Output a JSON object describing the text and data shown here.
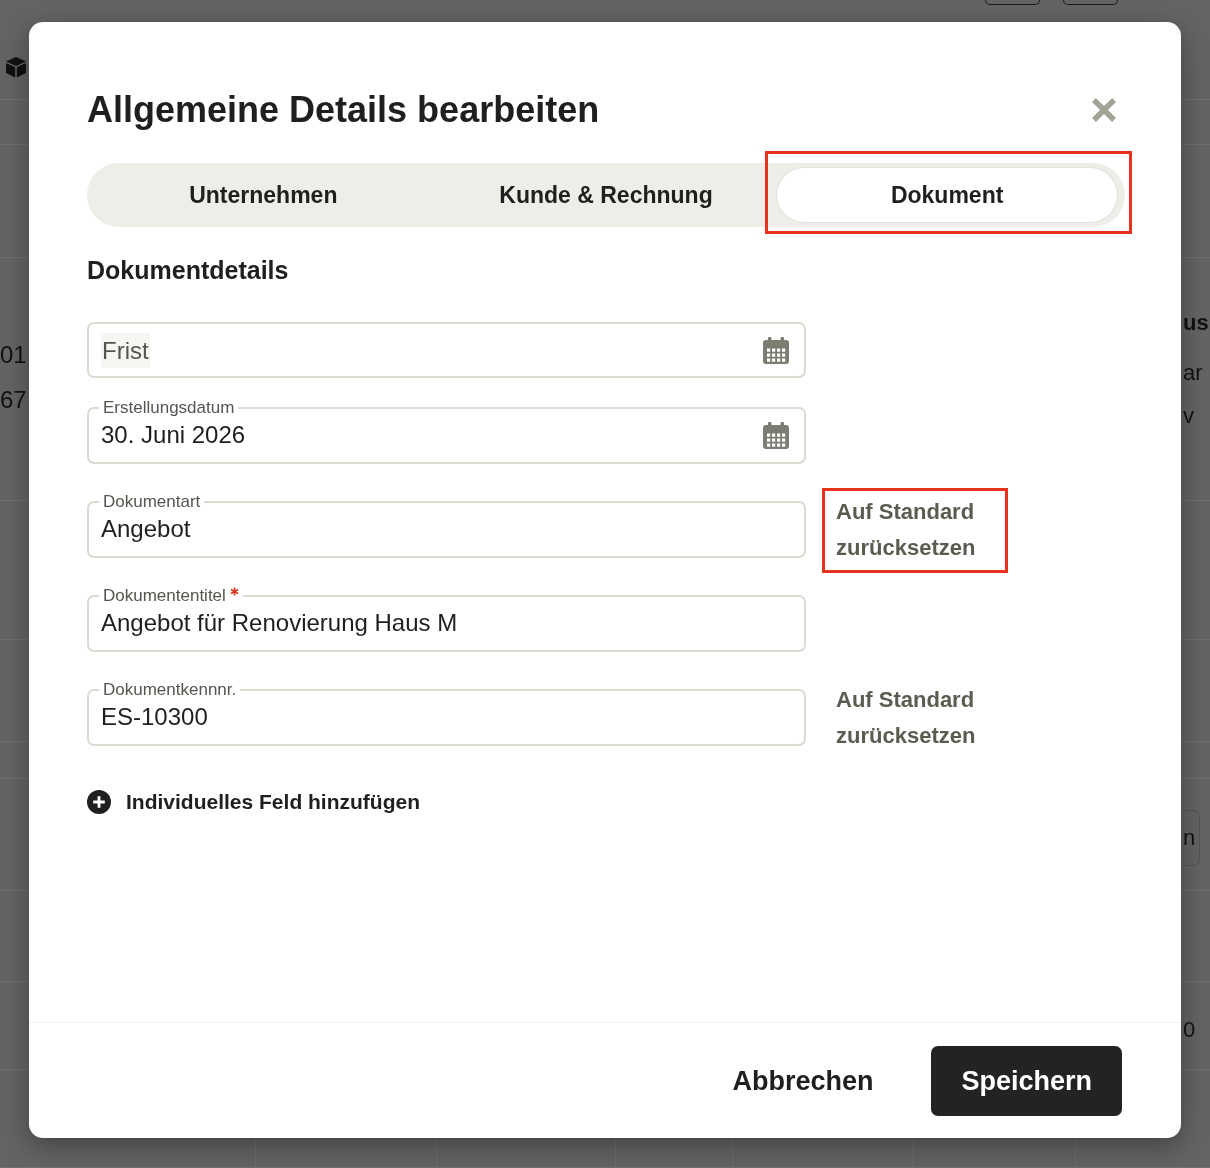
{
  "background_page": {
    "left_texts": [
      "01",
      "67"
    ],
    "right_texts": [
      {
        "kind": "heading",
        "text": "us"
      },
      {
        "kind": "text",
        "text": "ar"
      },
      {
        "kind": "text",
        "text": "v"
      }
    ],
    "right_button": "n",
    "right_amount": "0"
  },
  "dialog": {
    "title": "Allgemeine Details bearbeiten",
    "tabs": [
      {
        "label": "Unternehmen",
        "selected": false,
        "highlighted": false
      },
      {
        "label": "Kunde & Rechnung",
        "selected": false,
        "highlighted": false
      },
      {
        "label": "Dokument",
        "selected": true,
        "highlighted": true
      }
    ],
    "section_title": "Dokumentdetails",
    "fields": [
      {
        "kind": "date",
        "label": "Frist",
        "required": false
      },
      {
        "kind": "date",
        "label": "Erstellungsdatum",
        "value": "30. Juni 2026",
        "required": false
      },
      {
        "kind": "text",
        "label": "Dokumentart",
        "value": "Angebot",
        "required": false,
        "reset_link": {
          "label": "Auf Standard zurücksetzen",
          "highlighted": true
        }
      },
      {
        "kind": "text",
        "label": "Dokumententitel",
        "value": "Angebot für Renovierung Haus M",
        "required": true
      },
      {
        "kind": "text",
        "label": "Dokumentkennnr.",
        "value": "ES-10300",
        "required": false,
        "reset_link": {
          "label": "Auf Standard zurücksetzen",
          "highlighted": false
        }
      }
    ],
    "add_field_label": "Individuelles Feld hinzufügen",
    "buttons": [
      {
        "kind": "secondary",
        "label": "Abbrechen"
      },
      {
        "kind": "primary",
        "label": "Speichern"
      }
    ]
  }
}
